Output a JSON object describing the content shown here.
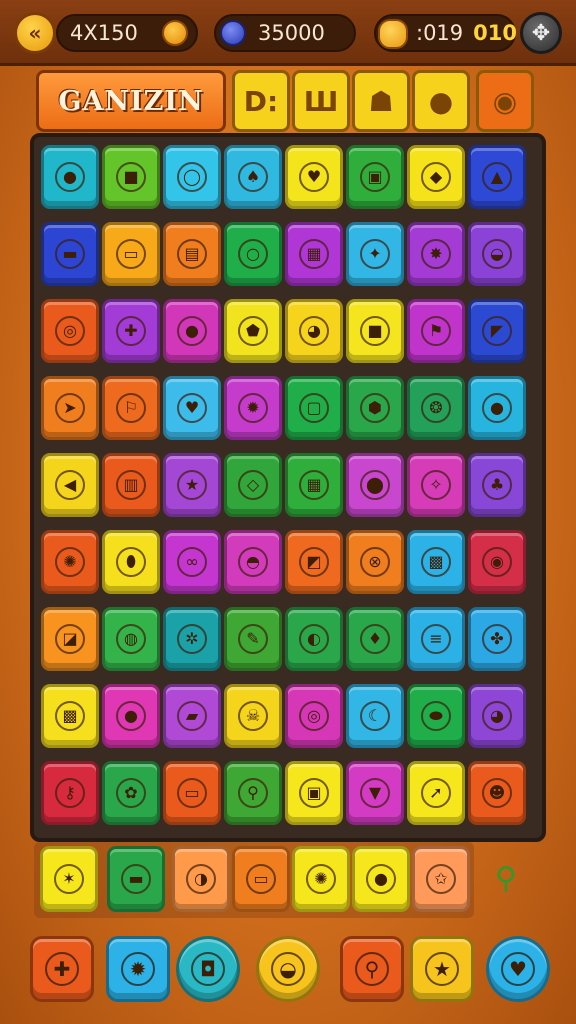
{
  "header": {
    "back_icon": "back-arrows-icon",
    "stat1": {
      "label": "4X150",
      "icon": "gold-coin-icon"
    },
    "stat2": {
      "label": "35000",
      "icon": "blue-gem-icon"
    },
    "stat3": {
      "label": ":019",
      "gold": "010",
      "icon": "cookie-icon"
    },
    "settings_icon": "settings-icon"
  },
  "title": {
    "text": "GANIZIN",
    "tiles": [
      {
        "glyph": "D:",
        "color": "#f6d21c"
      },
      {
        "glyph": "Ш",
        "color": "#f6d21c"
      },
      {
        "glyph": "☗",
        "color": "#f6d21c"
      },
      {
        "glyph": "●",
        "color": "#f6d21c"
      },
      {
        "glyph": "◉",
        "color": "#ec6d16"
      }
    ]
  },
  "board": {
    "rows": [
      [
        {
          "color": "#1fb7c9",
          "icon": "apple-icon",
          "glyph": "●"
        },
        {
          "color": "#63c52a",
          "icon": "gift-box-icon",
          "glyph": "■"
        },
        {
          "color": "#33c4ea",
          "icon": "egg-icon",
          "glyph": "◯"
        },
        {
          "color": "#2fb8e0",
          "icon": "leaf-icon",
          "glyph": "♠"
        },
        {
          "color": "#f3e41b",
          "icon": "strawberry-icon",
          "glyph": "♥"
        },
        {
          "color": "#2fae3c",
          "icon": "chest-icon",
          "glyph": "▣"
        },
        {
          "color": "#f6e21a",
          "icon": "acorn-icon",
          "glyph": "◆"
        },
        {
          "color": "#2d49d6",
          "icon": "cheese-icon",
          "glyph": "▲"
        }
      ],
      [
        {
          "color": "#2c45d2",
          "icon": "scroll-icon",
          "glyph": "▬"
        },
        {
          "color": "#f7a91a",
          "icon": "bread-icon",
          "glyph": "▭"
        },
        {
          "color": "#f07d1e",
          "icon": "book-icon",
          "glyph": "▤"
        },
        {
          "color": "#1fae4a",
          "icon": "ring-icon",
          "glyph": "○"
        },
        {
          "color": "#b136d6",
          "icon": "toaster-icon",
          "glyph": "▦"
        },
        {
          "color": "#32b6e6",
          "icon": "rocket-icon",
          "glyph": "✦"
        },
        {
          "color": "#a43bd4",
          "icon": "fox-icon",
          "glyph": "✸"
        },
        {
          "color": "#8b42d6",
          "icon": "turtle-icon",
          "glyph": "◒"
        }
      ],
      [
        {
          "color": "#ea5a1c",
          "icon": "fried-egg-icon",
          "glyph": "◎"
        },
        {
          "color": "#a33bd6",
          "icon": "puzzle-icon",
          "glyph": "✚"
        },
        {
          "color": "#d237b9",
          "icon": "chick-icon",
          "glyph": "●"
        },
        {
          "color": "#f1e41e",
          "icon": "shield-icon",
          "glyph": "⬟"
        },
        {
          "color": "#f7d41c",
          "icon": "bird-icon",
          "glyph": "◕"
        },
        {
          "color": "#f5e51e",
          "icon": "cube-icon",
          "glyph": "■"
        },
        {
          "color": "#c134cc",
          "icon": "flag-icon",
          "glyph": "⚑"
        },
        {
          "color": "#2c49d2",
          "icon": "kite-icon",
          "glyph": "◤"
        }
      ],
      [
        {
          "color": "#f07d1e",
          "icon": "paper-plane-icon",
          "glyph": "➤"
        },
        {
          "color": "#ee6a1e",
          "icon": "flag-box-icon",
          "glyph": "⚐"
        },
        {
          "color": "#3dbcec",
          "icon": "heart-icon",
          "glyph": "♥"
        },
        {
          "color": "#c53bcc",
          "icon": "sun-icon",
          "glyph": "✹"
        },
        {
          "color": "#1fae4a",
          "icon": "frame-icon",
          "glyph": "▢"
        },
        {
          "color": "#2aa74a",
          "icon": "badge-icon",
          "glyph": "⬢"
        },
        {
          "color": "#23a05a",
          "icon": "shell-icon",
          "glyph": "❂"
        },
        {
          "color": "#27b5e0",
          "icon": "cookies-icon",
          "glyph": "●"
        }
      ],
      [
        {
          "color": "#f4d51c",
          "icon": "fish-icon",
          "glyph": "◀"
        },
        {
          "color": "#ea5a1c",
          "icon": "jar-icon",
          "glyph": "▥"
        },
        {
          "color": "#a447d4",
          "icon": "star-icon",
          "glyph": "★"
        },
        {
          "color": "#31a63a",
          "icon": "kite-green-icon",
          "glyph": "◇"
        },
        {
          "color": "#2fae3c",
          "icon": "crate-icon",
          "glyph": "▦"
        },
        {
          "color": "#c947cf",
          "icon": "pin-icon",
          "glyph": "⬤"
        },
        {
          "color": "#d63bb8",
          "icon": "bone-icon",
          "glyph": "✧"
        },
        {
          "color": "#8847d6",
          "icon": "mushroom-icon",
          "glyph": "♣"
        }
      ],
      [
        {
          "color": "#ea5a1c",
          "icon": "crab-icon",
          "glyph": "✺"
        },
        {
          "color": "#f6df1c",
          "icon": "potion-icon",
          "glyph": "⬮"
        },
        {
          "color": "#c436cf",
          "icon": "link-icon",
          "glyph": "∞"
        },
        {
          "color": "#d33bbd",
          "icon": "dumpling-icon",
          "glyph": "◓"
        },
        {
          "color": "#ef6a1e",
          "icon": "box-icon",
          "glyph": "◩"
        },
        {
          "color": "#f07d1e",
          "icon": "chain-icon",
          "glyph": "⊗"
        },
        {
          "color": "#2cb2e6",
          "icon": "robot-icon",
          "glyph": "▩"
        },
        {
          "color": "#d42e48",
          "icon": "coin-q-icon",
          "glyph": "◉"
        }
      ],
      [
        {
          "color": "#f7931e",
          "icon": "package-icon",
          "glyph": "◪"
        },
        {
          "color": "#34b34a",
          "icon": "speech-icon",
          "glyph": "◍"
        },
        {
          "color": "#1aa2a8",
          "icon": "gear-icon",
          "glyph": "✲"
        },
        {
          "color": "#3fa733",
          "icon": "pencil-icon",
          "glyph": "✎"
        },
        {
          "color": "#2aa74a",
          "icon": "sushi-icon",
          "glyph": "◐"
        },
        {
          "color": "#2aa74a",
          "icon": "leaf-orange-icon",
          "glyph": "♦"
        },
        {
          "color": "#2cb1e6",
          "icon": "book-stack-icon",
          "glyph": "≡"
        },
        {
          "color": "#2ca8e4",
          "icon": "cookie-bits-icon",
          "glyph": "✤"
        }
      ],
      [
        {
          "color": "#f6df1c",
          "icon": "chest-brown-icon",
          "glyph": "▩"
        },
        {
          "color": "#e037b4",
          "icon": "peach-icon",
          "glyph": "●"
        },
        {
          "color": "#b049d6",
          "icon": "log-icon",
          "glyph": "▰"
        },
        {
          "color": "#f4d51c",
          "icon": "skull-icon",
          "glyph": "☠"
        },
        {
          "color": "#d637b6",
          "icon": "magnifier-green-icon",
          "glyph": "◎"
        },
        {
          "color": "#31b6e6",
          "icon": "banana-icon",
          "glyph": "☾"
        },
        {
          "color": "#1fae4a",
          "icon": "lemon-icon",
          "glyph": "⬬"
        },
        {
          "color": "#8d46d6",
          "icon": "bear-icon",
          "glyph": "◕"
        }
      ],
      [
        {
          "color": "#d82a3e",
          "icon": "key-icon",
          "glyph": "⚷"
        },
        {
          "color": "#2aa74a",
          "icon": "flower-icon",
          "glyph": "✿"
        },
        {
          "color": "#ea5a1c",
          "icon": "card-icon",
          "glyph": "▭"
        },
        {
          "color": "#3fa733",
          "icon": "search-icon",
          "glyph": "⚲"
        },
        {
          "color": "#f6e61c",
          "icon": "jar-red-icon",
          "glyph": "▣"
        },
        {
          "color": "#d43bc4",
          "icon": "fish-blue-icon",
          "glyph": "▼"
        },
        {
          "color": "#f6e61c",
          "icon": "arrow-green-icon",
          "glyph": "➚"
        },
        {
          "color": "#ea5a1c",
          "icon": "frog-icon",
          "glyph": "☻"
        }
      ]
    ]
  },
  "tray": [
    {
      "color": "#f6e61c",
      "icon": "bell-icon",
      "glyph": "✶"
    },
    {
      "color": "#2aa74a",
      "icon": "drum-icon",
      "glyph": "▬"
    },
    {
      "color": "#ff9a4a",
      "icon": "fish-round-icon",
      "glyph": "◑"
    },
    {
      "color": "#f07d1e",
      "icon": "laptop-icon",
      "glyph": "▭"
    },
    {
      "color": "#f6e61c",
      "icon": "crab-small-icon",
      "glyph": "✺"
    },
    {
      "color": "#f6e61c",
      "icon": "cookie-chip-icon",
      "glyph": "●"
    },
    {
      "color": "#ff9a5a",
      "icon": "starfish-icon",
      "glyph": "✩"
    }
  ],
  "extra_item": {
    "icon": "lollipop-icon",
    "glyph": "⚲"
  },
  "boosters": [
    {
      "color": "#ea5a1c",
      "icon": "puzzle-piece-icon",
      "glyph": "✚",
      "round": false
    },
    {
      "color": "#2cb2e6",
      "icon": "burst-icon",
      "glyph": "✹",
      "round": false
    },
    {
      "color": "#2ab9c4",
      "icon": "camera-icon",
      "glyph": "◘",
      "round": true
    },
    {
      "color": "#f6c41c",
      "icon": "rainbow-ball-icon",
      "glyph": "◒",
      "round": true
    },
    {
      "color": "#ea5a1c",
      "icon": "magnifier-icon",
      "glyph": "⚲",
      "round": false
    },
    {
      "color": "#f6c41c",
      "icon": "star-icon",
      "glyph": "★",
      "round": false
    },
    {
      "color": "#2cb2e6",
      "icon": "heart-gem-icon",
      "glyph": "♥",
      "round": true
    }
  ]
}
